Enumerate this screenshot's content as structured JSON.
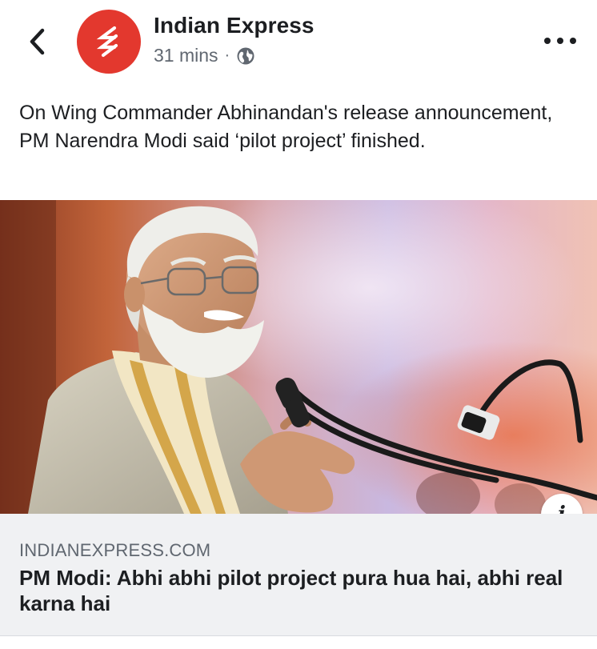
{
  "header": {
    "page_name": "Indian Express",
    "time": "31 mins",
    "separator": "·",
    "privacy_icon": "globe-icon",
    "back_icon": "chevron-left-icon",
    "more_icon": "more-horizontal-icon",
    "avatar_color": "#e3382e"
  },
  "post": {
    "text": "On Wing Commander Abhinandan's release announcement, PM Narendra Modi said ‘pilot project’ finished."
  },
  "link_preview": {
    "image_alt": "PM Narendra Modi speaking at a microphone",
    "info_icon": "info-icon",
    "info_label": "i",
    "domain": "INDIANEXPRESS.COM",
    "title": "PM Modi: Abhi abhi pilot project pura hua hai, abhi real karna hai"
  }
}
